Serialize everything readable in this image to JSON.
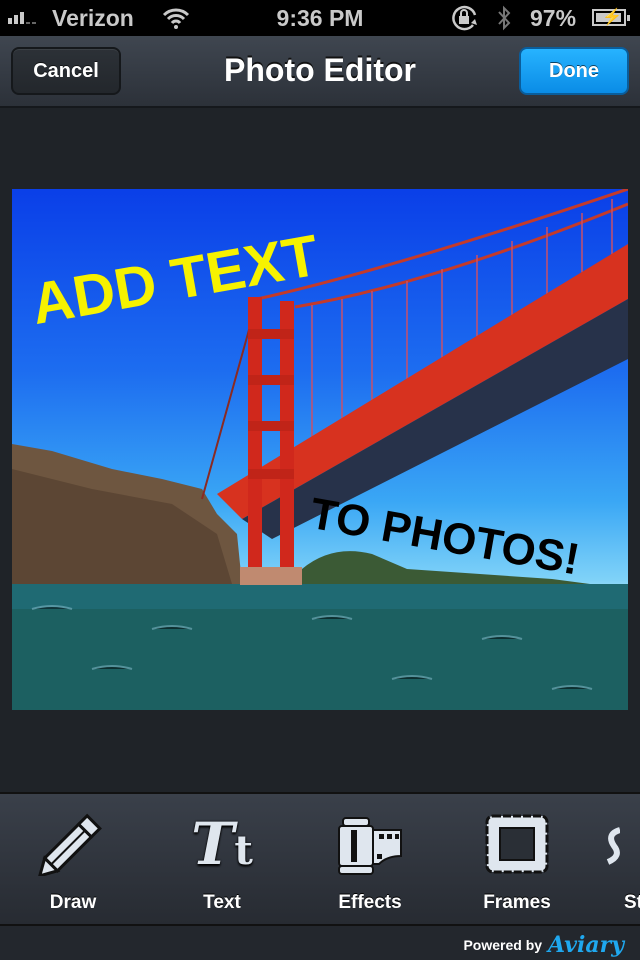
{
  "status_bar": {
    "carrier": "Verizon",
    "time": "9:36 PM",
    "battery_percent": "97%",
    "battery_level": 0.97,
    "icons": [
      "signal-icon",
      "wifi-icon",
      "rotation-lock-icon",
      "bluetooth-icon",
      "battery-charging-icon"
    ]
  },
  "nav": {
    "title": "Photo Editor",
    "cancel_label": "Cancel",
    "done_label": "Done",
    "done_color": "#129fff"
  },
  "photo": {
    "description": "Golden Gate Bridge over water",
    "overlay_text_1": "ADD TEXT",
    "overlay_text_1_color": "#f6f200",
    "overlay_text_2": "TO PHOTOS!",
    "overlay_text_2_color": "#000000"
  },
  "toolbar": {
    "tools": [
      {
        "label": "Draw",
        "icon": "pencil-icon"
      },
      {
        "label": "Text",
        "icon": "text-icon"
      },
      {
        "label": "Effects",
        "icon": "film-icon"
      },
      {
        "label": "Frames",
        "icon": "frame-icon"
      },
      {
        "label": "St",
        "icon": "sticker-icon"
      }
    ]
  },
  "footer": {
    "powered_by": "Powered by",
    "brand": "Aviary"
  }
}
